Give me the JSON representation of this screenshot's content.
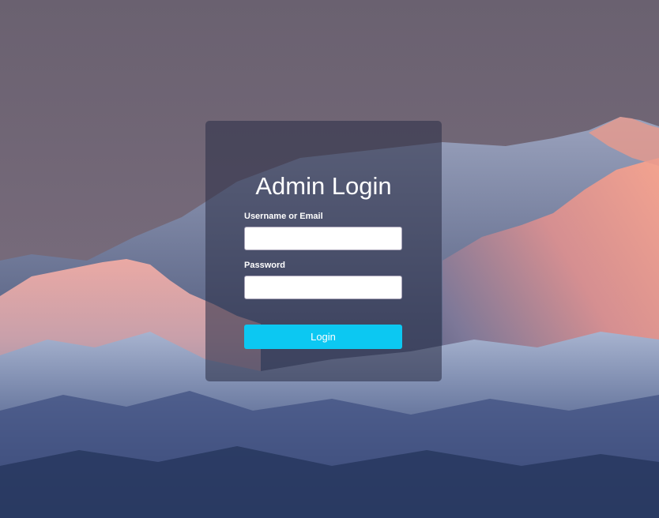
{
  "login": {
    "title": "Admin Login",
    "username_label": "Username or Email",
    "username_value": "",
    "password_label": "Password",
    "password_value": "",
    "button_label": "Login"
  },
  "colors": {
    "button": "#0cc8f2",
    "card": "#2d3048",
    "sky": "#6f6576",
    "text": "#ffffff"
  }
}
